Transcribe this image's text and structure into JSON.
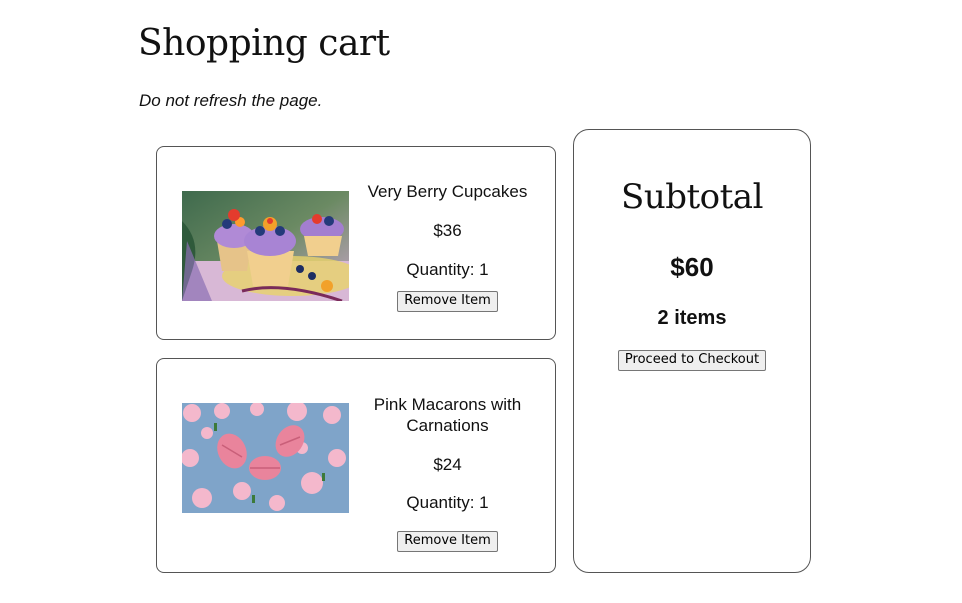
{
  "page": {
    "title": "Shopping cart",
    "notice": "Do not refresh the page."
  },
  "cart": {
    "items": [
      {
        "name": "Very Berry Cupcakes",
        "price": "$36",
        "quantity": "Quantity: 1",
        "remove_label": "Remove Item",
        "image_icon": "cupcakes-photo"
      },
      {
        "name": "Pink Macarons with Carnations",
        "price": "$24",
        "quantity": "Quantity: 1",
        "remove_label": "Remove Item",
        "image_icon": "macarons-photo"
      }
    ]
  },
  "summary": {
    "title": "Subtotal",
    "amount": "$60",
    "count": "2 items",
    "checkout_label": "Proceed to Checkout"
  },
  "colors": {
    "border": "#555555",
    "button_bg": "#efefef",
    "button_border": "#767676"
  }
}
